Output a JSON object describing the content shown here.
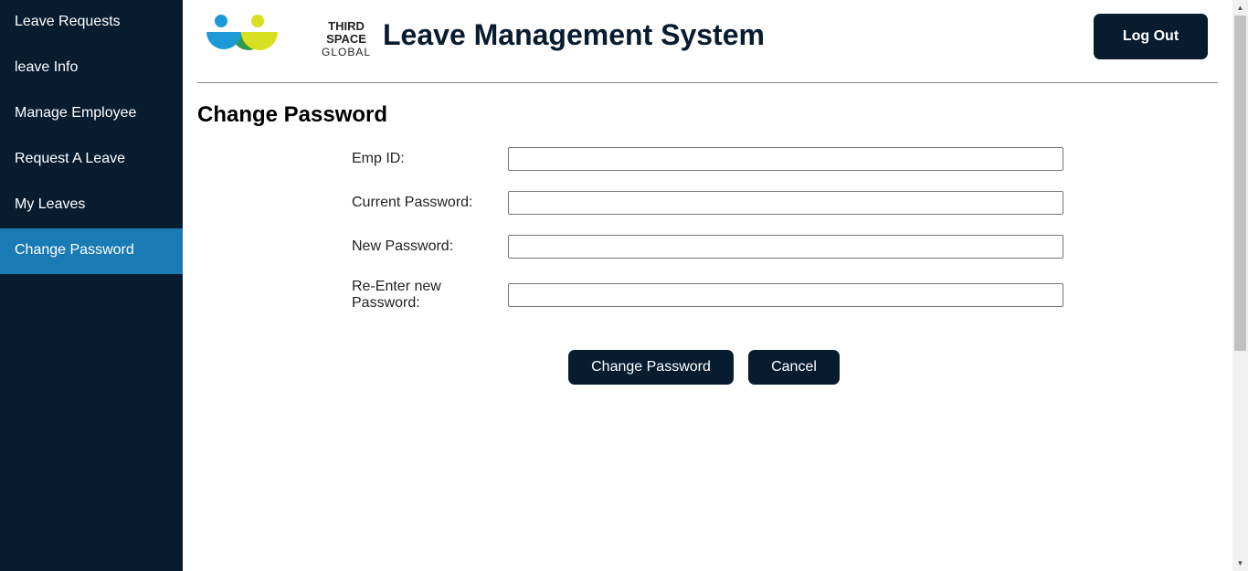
{
  "sidebar": {
    "items": [
      {
        "label": "Leave Requests"
      },
      {
        "label": "leave Info"
      },
      {
        "label": "Manage Employee"
      },
      {
        "label": "Request A Leave"
      },
      {
        "label": "My Leaves"
      },
      {
        "label": "Change Password"
      }
    ],
    "active_index": 5
  },
  "header": {
    "logo_line1": "THIRD SPACE",
    "logo_line2": "GLOBAL",
    "title": "Leave Management System",
    "logout_label": "Log Out"
  },
  "form": {
    "title": "Change Password",
    "fields": [
      {
        "label": "Emp ID:",
        "value": ""
      },
      {
        "label": "Current Password:",
        "value": ""
      },
      {
        "label": "New Password:",
        "value": ""
      },
      {
        "label": "Re-Enter new Password:",
        "value": ""
      }
    ],
    "submit_label": "Change Password",
    "cancel_label": "Cancel"
  },
  "colors": {
    "sidebar_bg": "#081c30",
    "sidebar_active": "#1a7ab4",
    "button_bg": "#081c30",
    "logo_blue": "#1e9bd7",
    "logo_green": "#2e9a45",
    "logo_yellow": "#d9e021"
  }
}
